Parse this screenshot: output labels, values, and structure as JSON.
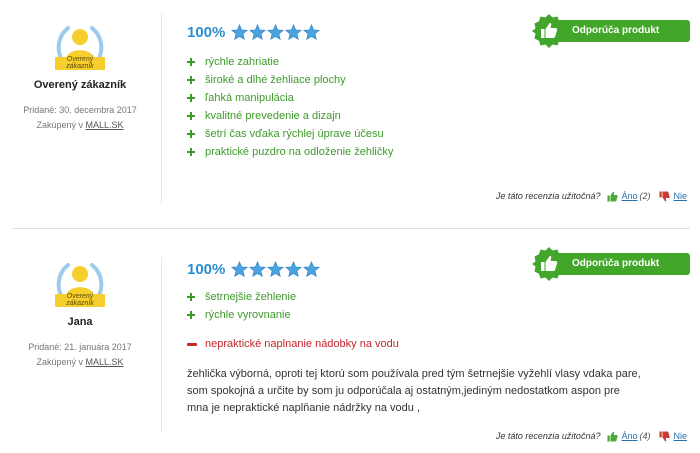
{
  "colors": {
    "accent": "#2a8fcf",
    "pro": "#3e9a2b",
    "con": "#c4262a",
    "recommend": "#42a62a",
    "star": "#4aa3e0"
  },
  "reviews": [
    {
      "badge_text": "Overený zákazník",
      "author": "Overený zákazník",
      "added": "Pridané: 30. decembra 2017",
      "bought_prefix": "Zakúpený v ",
      "bought_shop": "MALL.SK",
      "score": "100%",
      "stars": 5,
      "recommend": "Odporúča produkt",
      "pros": [
        "rýchle zahriatie",
        "široké a dlhé žehliace plochy",
        "ľahká manipulácia",
        "kvalitné prevedenie a dizajn",
        "šetrí čas vďaka rýchlej úprave účesu",
        "praktické puzdro na odloženie žehličky"
      ],
      "cons": [],
      "helpful_question": "Je táto recenzia užitočná?",
      "yes_label": "Áno",
      "yes_count": "(2)",
      "no_label": "Nie"
    },
    {
      "badge_text": "Overený zákazník",
      "author": "Jana",
      "added": "Pridané: 21. januára 2017",
      "bought_prefix": "Zakúpený v ",
      "bought_shop": "MALL.SK",
      "score": "100%",
      "stars": 5,
      "recommend": "Odporúča produkt",
      "pros": [
        "šetrnejšie žehlenie",
        "rýchle vyrovnanie"
      ],
      "cons": [
        "nepraktické naplnanie nádobky na vodu"
      ],
      "text_lines": [
        "žehlička výborná, oproti tej ktorú som používala pred tým šetrnejšie vyžehlí vlasy vdaka pare,",
        "som spokojná a určite by som ju odporúčala aj ostatným,jediným nedostatkom aspon pre",
        "mna je nepraktické naplňanie nádržky na vodu ,"
      ],
      "helpful_question": "Je táto recenzia užitočná?",
      "yes_label": "Áno",
      "yes_count": "(4)",
      "no_label": "Nie"
    }
  ]
}
